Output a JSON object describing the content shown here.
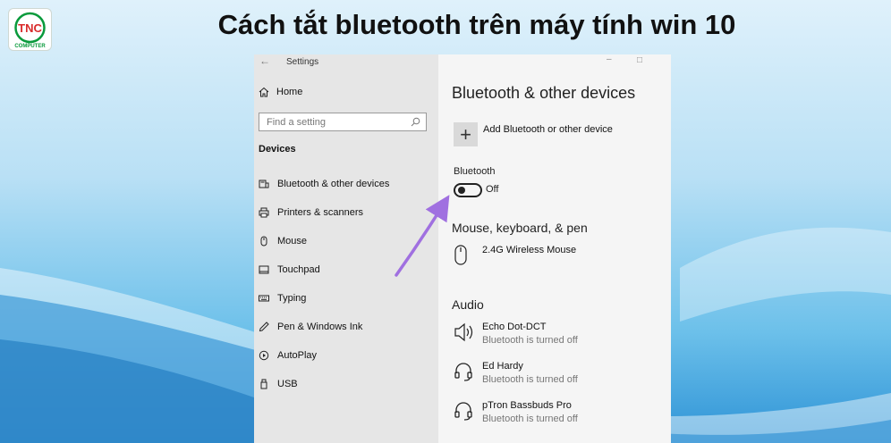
{
  "headline": "Cách tắt bluetooth trên máy tính win 10",
  "logo": {
    "text": "TNC",
    "sub": "COMPUTER"
  },
  "window": {
    "title": "Settings",
    "left": {
      "home": "Home",
      "search_placeholder": "Find a setting",
      "section": "Devices",
      "items": [
        {
          "label": "Bluetooth & other devices",
          "icon": "bluetooth-devices-icon"
        },
        {
          "label": "Printers & scanners",
          "icon": "printer-icon"
        },
        {
          "label": "Mouse",
          "icon": "mouse-icon"
        },
        {
          "label": "Touchpad",
          "icon": "touchpad-icon"
        },
        {
          "label": "Typing",
          "icon": "keyboard-icon"
        },
        {
          "label": "Pen & Windows Ink",
          "icon": "pen-icon"
        },
        {
          "label": "AutoPlay",
          "icon": "autoplay-icon"
        },
        {
          "label": "USB",
          "icon": "usb-icon"
        }
      ]
    },
    "right": {
      "title": "Bluetooth & other devices",
      "add_device": "Add Bluetooth or other device",
      "bluetooth_label": "Bluetooth",
      "bluetooth_state": "Off",
      "bluetooth_on": false,
      "mouse_section": "Mouse, keyboard, & pen",
      "mouse_device": "2.4G Wireless Mouse",
      "audio_section": "Audio",
      "audio_devices": [
        {
          "name": "Echo Dot-DCT",
          "status": "Bluetooth is turned off",
          "icon": "speaker-icon"
        },
        {
          "name": "Ed Hardy",
          "status": "Bluetooth is turned off",
          "icon": "headset-icon"
        },
        {
          "name": "pTron Bassbuds Pro",
          "status": "Bluetooth is turned off",
          "icon": "headset-icon"
        }
      ]
    }
  },
  "colors": {
    "arrow": "#a070e0",
    "logo_green": "#0a9a3c",
    "logo_red": "#d92b2b"
  }
}
